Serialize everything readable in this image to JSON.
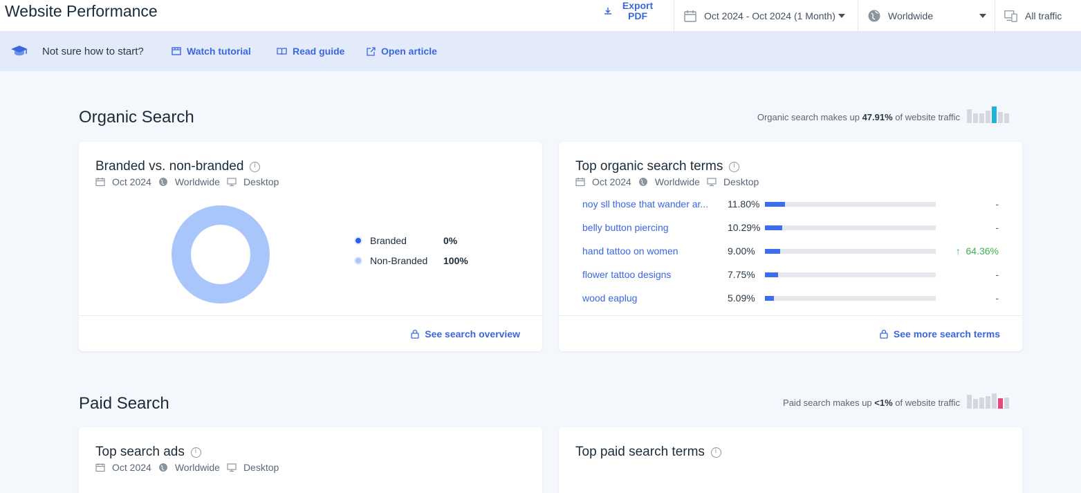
{
  "header": {
    "title": "Website Performance",
    "export_label": "Export PDF",
    "date_range": "Oct 2024 - Oct 2024 (1 Month)",
    "region": "Worldwide",
    "traffic": "All traffic"
  },
  "help": {
    "question": "Not sure how to start?",
    "links": [
      "Watch tutorial",
      "Read guide",
      "Open article"
    ]
  },
  "organic": {
    "title": "Organic Search",
    "note_prefix": "Organic search makes up",
    "note_value": "47.91%",
    "note_suffix": "of website traffic",
    "accent": "#1fb1d6",
    "branded_card": {
      "title": "Branded vs. non-branded",
      "date": "Oct 2024",
      "region": "Worldwide",
      "device": "Desktop",
      "legend": [
        {
          "name": "Branded",
          "value": "0%",
          "color": "#2f5fe6"
        },
        {
          "name": "Non-Branded",
          "value": "100%",
          "color": "#a9c6fb"
        }
      ],
      "footer_link": "See search overview"
    },
    "terms_card": {
      "title": "Top organic search terms",
      "date": "Oct 2024",
      "region": "Worldwide",
      "device": "Desktop",
      "terms": [
        {
          "term": "noy sll those that wander ar...",
          "share": "11.80%",
          "fill": 0.118,
          "change": "-",
          "trend": ""
        },
        {
          "term": "belly button piercing",
          "share": "10.29%",
          "fill": 0.1029,
          "change": "-",
          "trend": ""
        },
        {
          "term": "hand tattoo on women",
          "share": "9.00%",
          "fill": 0.09,
          "change": "64.36%",
          "trend": "up"
        },
        {
          "term": "flower tattoo designs",
          "share": "7.75%",
          "fill": 0.0775,
          "change": "-",
          "trend": ""
        },
        {
          "term": "wood eaplug",
          "share": "5.09%",
          "fill": 0.0509,
          "change": "-",
          "trend": ""
        }
      ],
      "footer_link": "See more search terms"
    }
  },
  "paid": {
    "title": "Paid Search",
    "note_prefix": "Paid search makes up",
    "note_value": "<1%",
    "note_suffix": "of website traffic",
    "accent": "#e8457a",
    "ads_card": {
      "title": "Top search ads",
      "date": "Oct 2024",
      "region": "Worldwide",
      "device": "Desktop"
    },
    "terms_card": {
      "title": "Top paid search terms"
    }
  }
}
